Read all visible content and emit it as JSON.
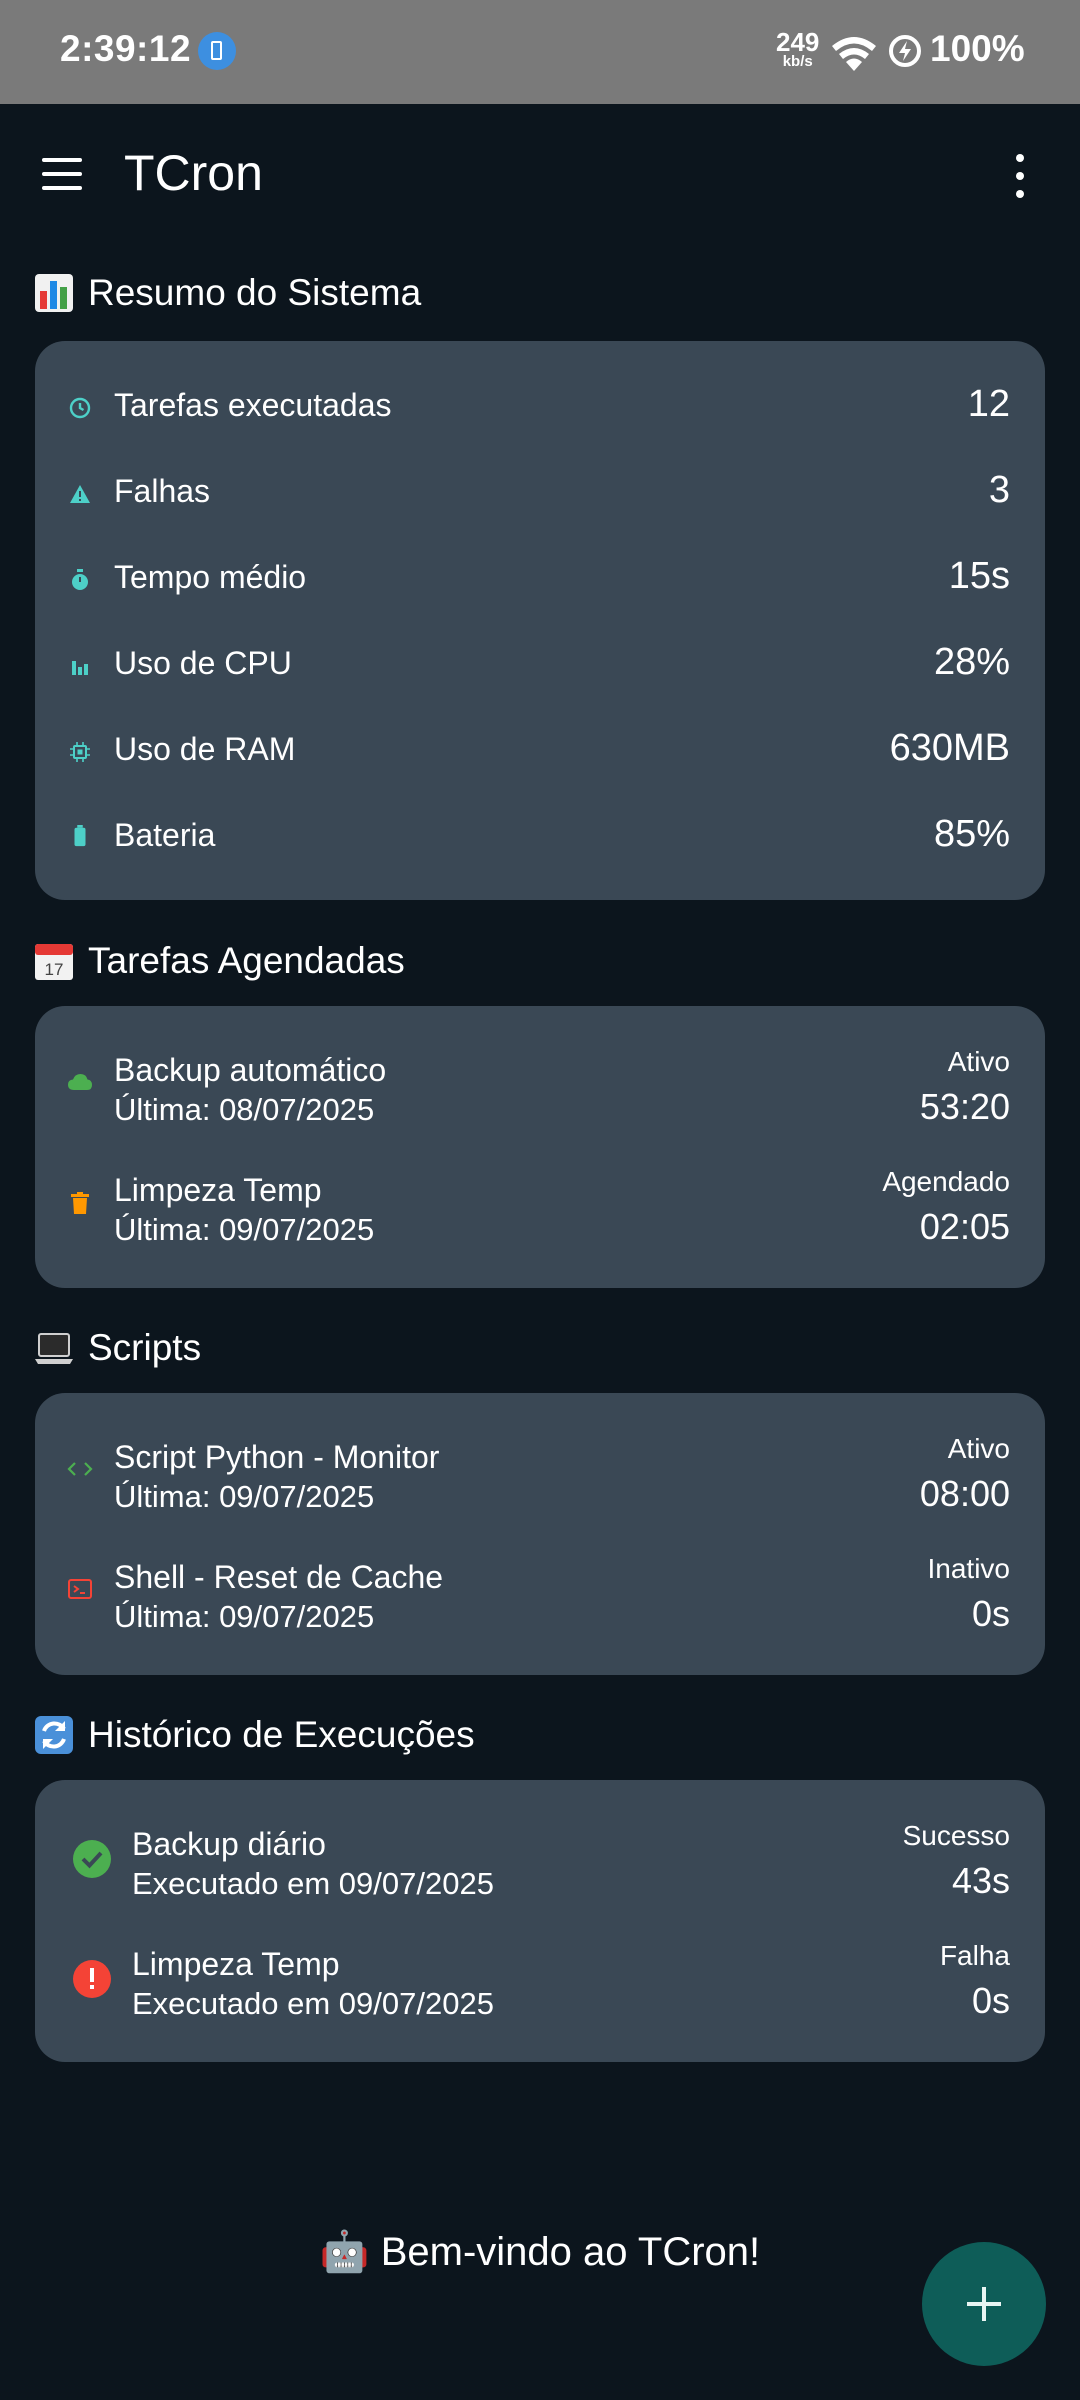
{
  "status_bar": {
    "time": "2:39:12",
    "net_speed": "249",
    "net_unit": "kb/s",
    "battery": "100%"
  },
  "app_bar": {
    "title": "TCron"
  },
  "summary": {
    "title": "Resumo do Sistema",
    "items": [
      {
        "label": "Tarefas executadas",
        "value": "12",
        "icon": "clock-icon"
      },
      {
        "label": "Falhas",
        "value": "3",
        "icon": "warning-icon"
      },
      {
        "label": "Tempo médio",
        "value": "15s",
        "icon": "timer-icon"
      },
      {
        "label": "Uso de CPU",
        "value": "28%",
        "icon": "bar-chart-icon"
      },
      {
        "label": "Uso de RAM",
        "value": "630MB",
        "icon": "memory-chip-icon"
      },
      {
        "label": "Bateria",
        "value": "85%",
        "icon": "battery-icon"
      }
    ]
  },
  "scheduled": {
    "title": "Tarefas Agendadas",
    "items": [
      {
        "name": "Backup automático",
        "last": "Última: 08/07/2025",
        "status": "Ativo",
        "time": "53:20",
        "icon": "cloud-icon"
      },
      {
        "name": "Limpeza Temp",
        "last": "Última: 09/07/2025",
        "status": "Agendado",
        "time": "02:05",
        "icon": "trash-icon"
      }
    ]
  },
  "scripts": {
    "title": "Scripts",
    "items": [
      {
        "name": "Script Python - Monitor",
        "last": "Última: 09/07/2025",
        "status": "Ativo",
        "time": "08:00",
        "icon": "code-icon"
      },
      {
        "name": "Shell - Reset de Cache",
        "last": "Última: 09/07/2025",
        "status": "Inativo",
        "time": "0s",
        "icon": "terminal-icon"
      }
    ]
  },
  "history": {
    "title": "Histórico de Execuções",
    "items": [
      {
        "name": "Backup diário",
        "detail": "Executado em 09/07/2025",
        "status": "Sucesso",
        "duration": "43s",
        "icon": "check-circle-icon"
      },
      {
        "name": "Limpeza Temp",
        "detail": "Executado em 09/07/2025",
        "status": "Falha",
        "duration": "0s",
        "icon": "error-circle-icon"
      }
    ]
  },
  "welcome": "🤖 Bem-vindo ao TCron!",
  "colors": {
    "background": "#0c151d",
    "card": "#3a4855",
    "accent_teal": "#4dd0c8",
    "success": "#4caf50",
    "error": "#f44336",
    "warning_orange": "#ff9800",
    "fab": "#0e5d58"
  }
}
